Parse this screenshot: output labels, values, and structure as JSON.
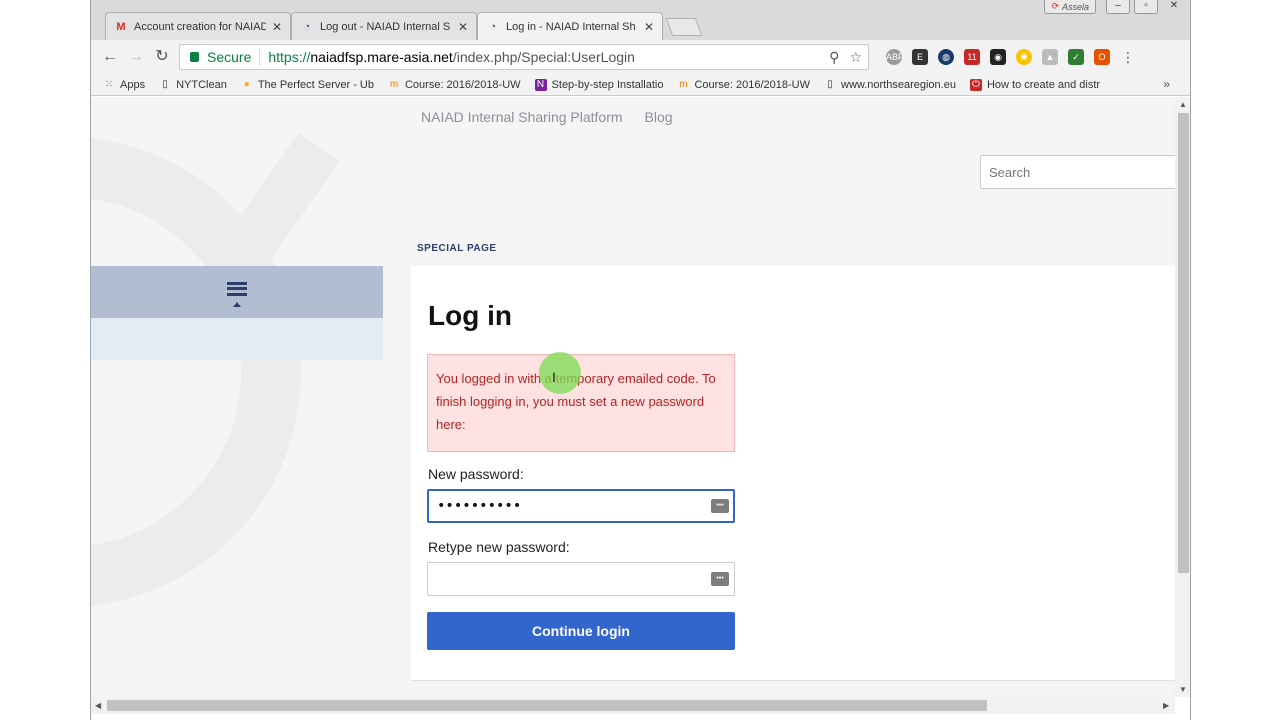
{
  "browser": {
    "tabs": [
      {
        "title": "Account creation for NAIAD",
        "icon": "gmail-icon"
      },
      {
        "title": "Log out - NAIAD Internal S",
        "icon": "site-icon"
      },
      {
        "title": "Log in - NAIAD Internal Sh",
        "icon": "site-icon",
        "active": true
      }
    ],
    "user": "Assela",
    "secure_label": "Secure",
    "url_scheme": "https://",
    "url_host": "naiadfsp.mare-asia.net",
    "url_path": "/index.php/Special:UserLogin",
    "bookmarks": [
      {
        "label": "Apps",
        "icon": "apps-grid-icon"
      },
      {
        "label": "NYTClean",
        "icon": "page-icon"
      },
      {
        "label": "The Perfect Server - Ub",
        "icon": "bulb-icon"
      },
      {
        "label": "Course: 2016/2018-UW",
        "icon": "moodle-icon"
      },
      {
        "label": "Step-by-step Installatio",
        "icon": "onenote-icon"
      },
      {
        "label": "Course: 2016/2018-UW",
        "icon": "moodle-icon"
      },
      {
        "label": "www.northsearegion.eu",
        "icon": "page-icon"
      },
      {
        "label": "How to create and distr",
        "icon": "power-icon"
      }
    ],
    "bookmarks_more": "»"
  },
  "site": {
    "nav": [
      "NAIAD Internal Sharing Platform",
      "Blog"
    ],
    "search_placeholder": "Search",
    "breadcrumb": "SPECIAL PAGE"
  },
  "login": {
    "title": "Log in",
    "error": "You logged in with a temporary emailed code. To finish logging in, you must set a new password here:",
    "new_password_label": "New password:",
    "new_password_value": "••••••••••",
    "retype_label": "Retype new password:",
    "retype_value": "",
    "continue_label": "Continue login"
  },
  "colors": {
    "accent": "#3366cc",
    "error_bg": "#fde2e1",
    "error_text": "#b32424"
  }
}
